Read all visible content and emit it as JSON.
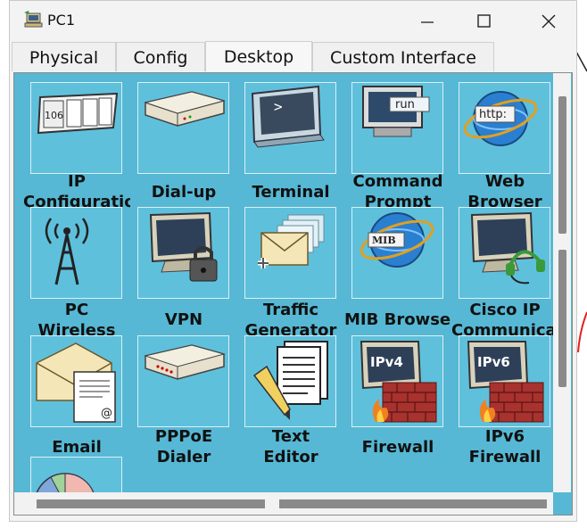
{
  "window": {
    "title": "PC1"
  },
  "tabs": [
    {
      "label": "Physical",
      "active": false
    },
    {
      "label": "Config",
      "active": false
    },
    {
      "label": "Desktop",
      "active": true
    },
    {
      "label": "Custom Interface",
      "active": false
    }
  ],
  "apps": [
    {
      "line1": "IP",
      "line2": "Configuration",
      "icon": "ip-configuration-icon",
      "badge": "106"
    },
    {
      "line1": "",
      "line2": "Dial-up",
      "icon": "modem-icon"
    },
    {
      "line1": "",
      "line2": "Terminal",
      "icon": "terminal-icon",
      "badge": ">"
    },
    {
      "line1": "Command",
      "line2": "Prompt",
      "icon": "command-prompt-icon",
      "badge": "run"
    },
    {
      "line1": "Web",
      "line2": "Browser",
      "icon": "web-browser-icon",
      "badge": "http:"
    },
    {
      "line1": "PC",
      "line2": "Wireless",
      "icon": "wireless-tower-icon"
    },
    {
      "line1": "VPN",
      "line2": "",
      "icon": "vpn-lock-icon"
    },
    {
      "line1": "Traffic",
      "line2": "Generator",
      "icon": "traffic-generator-icon"
    },
    {
      "line1": "MIB Browser",
      "line2": "",
      "icon": "mib-browser-icon",
      "badge": "MIB"
    },
    {
      "line1": "Cisco IP",
      "line2": "Communicator",
      "icon": "headset-icon"
    },
    {
      "line1": "",
      "line2": "Email",
      "icon": "email-icon",
      "badge": "@"
    },
    {
      "line1": "PPPoE",
      "line2": "Dialer",
      "icon": "pppoe-dialer-icon"
    },
    {
      "line1": "Text",
      "line2": "Editor",
      "icon": "text-editor-icon"
    },
    {
      "line1": "",
      "line2": "Firewall",
      "icon": "firewall-icon",
      "badge": "IPv4"
    },
    {
      "line1": "IPv6",
      "line2": "Firewall",
      "icon": "ipv6-firewall-icon",
      "badge": "IPv6"
    },
    {
      "line1": "",
      "line2": "",
      "icon": "pie-chart-icon"
    }
  ],
  "colors": {
    "desktop_bg": "#56b8d4",
    "tile_bg": "#5fc0dc"
  }
}
